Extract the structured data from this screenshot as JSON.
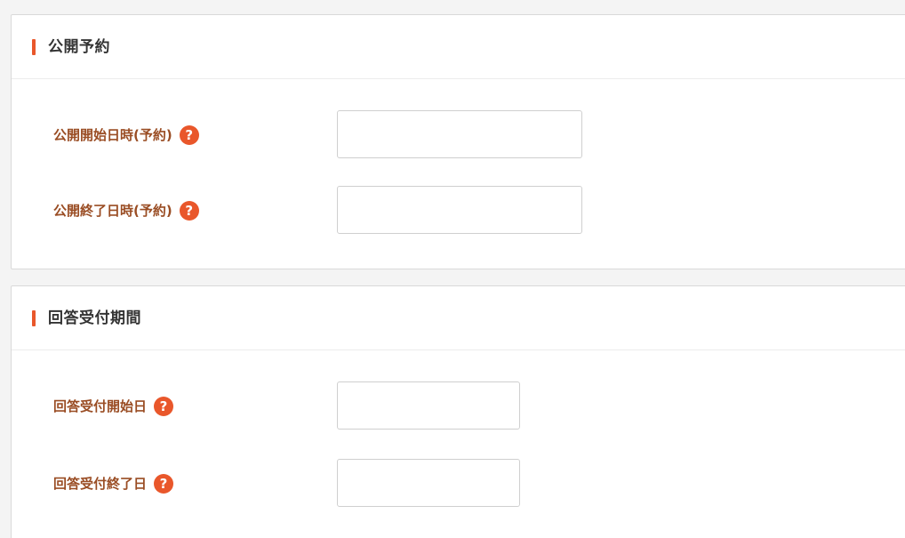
{
  "sections": [
    {
      "title": "公開予約",
      "fields": [
        {
          "label": "公開開始日時(予約)",
          "help": "?",
          "value": ""
        },
        {
          "label": "公開終了日時(予約)",
          "help": "?",
          "value": ""
        }
      ]
    },
    {
      "title": "回答受付期間",
      "fields": [
        {
          "label": "回答受付開始日",
          "help": "?",
          "value": ""
        },
        {
          "label": "回答受付終了日",
          "help": "?",
          "value": ""
        }
      ]
    }
  ],
  "colors": {
    "accent": "#e9572b",
    "label": "#9a4d24",
    "title": "#333333"
  }
}
